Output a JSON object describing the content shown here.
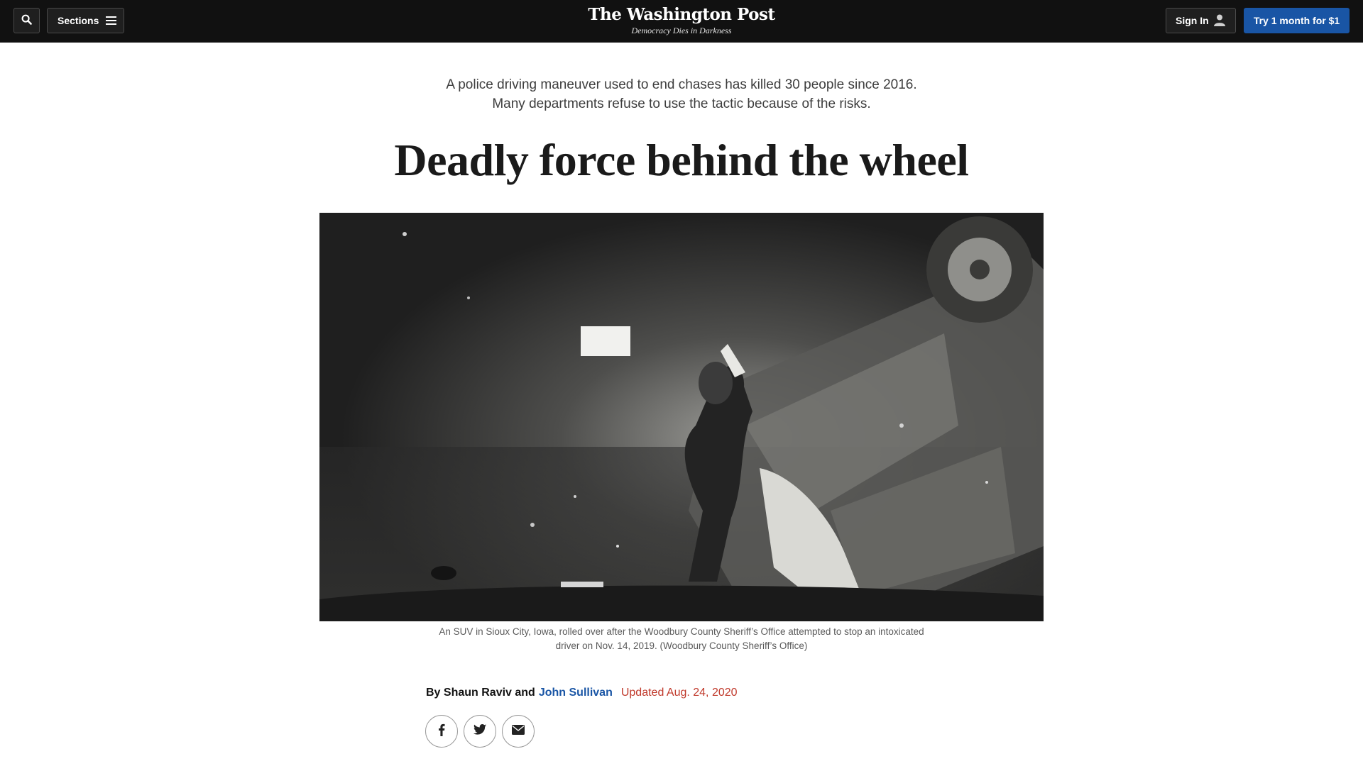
{
  "header": {
    "search_icon": "search-icon",
    "sections_label": "Sections",
    "sections_icon": "hamburger-icon",
    "brand_name": "The Washington Post",
    "brand_tagline": "Democracy Dies in Darkness",
    "signin_label": "Sign In",
    "signin_icon": "user-icon",
    "trial_label": "Try 1 month for $1",
    "colors": {
      "bar": "#111111",
      "trial_button": "#1955a5"
    }
  },
  "article": {
    "dek_line1": "A police driving maneuver used to end chases has killed 30 people since 2016.",
    "dek_line2": "Many departments refuse to use the tactic because of the risks.",
    "headline": "Deadly force behind the wheel",
    "caption_line1": "An SUV in Sioux City, Iowa, rolled over after the Woodbury County Sheriff’s Office attempted to stop an intoxicated",
    "caption_line2": "driver on Nov. 14, 2019. (Woodbury County Sheriff’s Office)",
    "byline": {
      "prefix": "By Shaun Raviv and",
      "linked_author": "John Sullivan",
      "updated": "Updated Aug. 24, 2020"
    },
    "share": [
      "facebook-icon",
      "twitter-icon",
      "email-icon"
    ],
    "colors": {
      "link": "#1955a5",
      "updated": "#c0392b"
    }
  }
}
